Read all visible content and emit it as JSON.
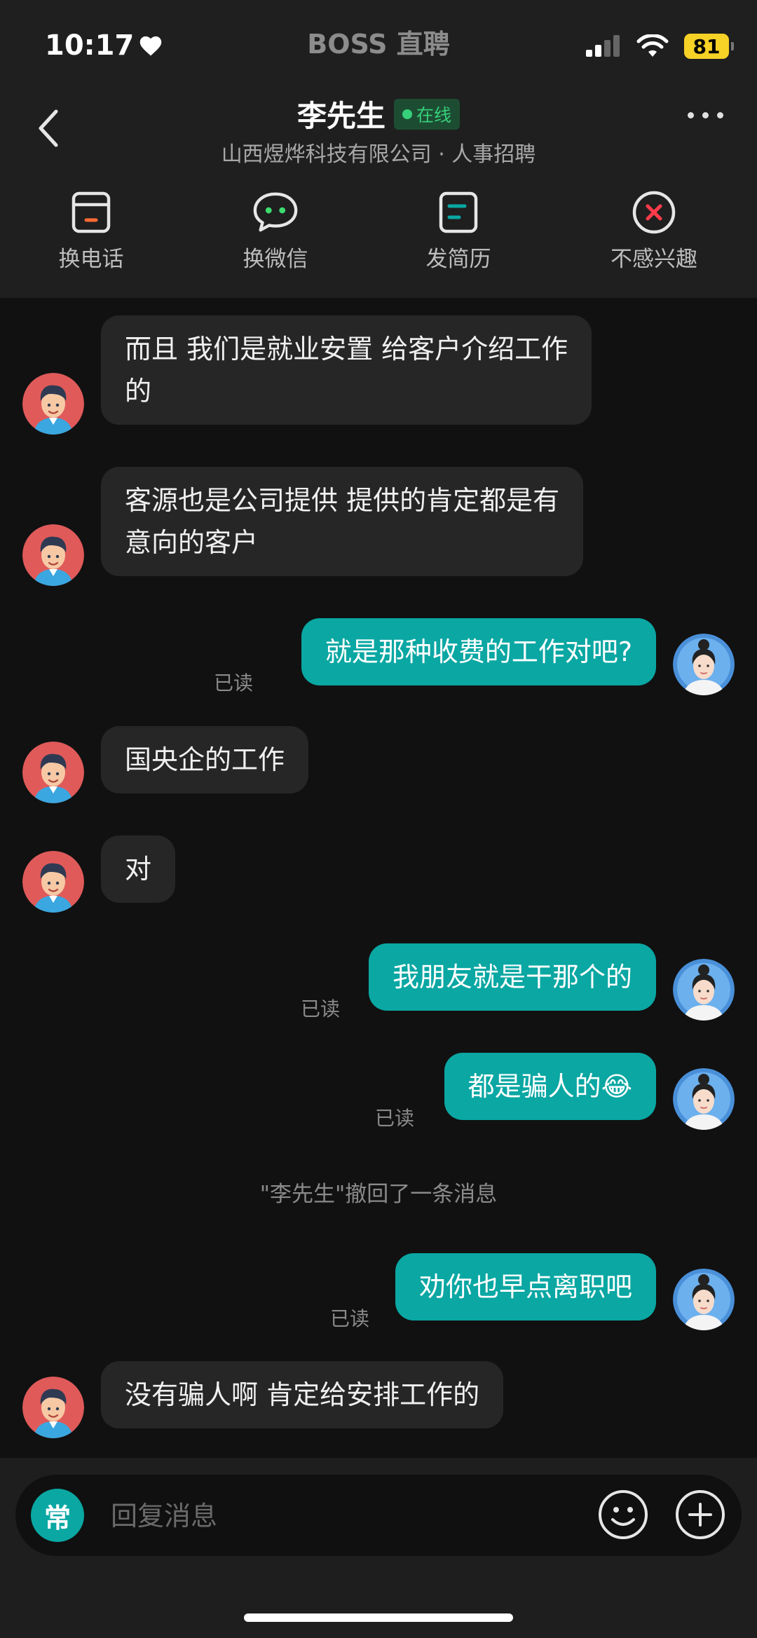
{
  "status": {
    "time": "10:17",
    "app_name": "BOSS 直聘",
    "battery": "81"
  },
  "header": {
    "name": "李先生",
    "online": "在线",
    "subtitle": "山西煜烨科技有限公司 · 人事招聘"
  },
  "actions": [
    {
      "label": "换电话",
      "icon": "phone-card-icon"
    },
    {
      "label": "换微信",
      "icon": "wechat-icon"
    },
    {
      "label": "发简历",
      "icon": "resume-icon"
    },
    {
      "label": "不感兴趣",
      "icon": "not-interested-icon"
    }
  ],
  "messages": {
    "m1": {
      "line1": "而且 我们是就业安置 给客户介绍工作",
      "line2": "的"
    },
    "m2": {
      "line1": "客源也是公司提供  提供的肯定都是有",
      "line2": "意向的客户"
    },
    "m3": {
      "text": "就是那种收费的工作对吧?",
      "status": "已读"
    },
    "m4": {
      "text": "国央企的工作"
    },
    "m5": {
      "text": "对"
    },
    "m6": {
      "text": "我朋友就是干那个的",
      "status": "已读"
    },
    "m7": {
      "text": "都是骗人的",
      "emoji": "😂",
      "status": "已读"
    },
    "recall": "\"李先生\"撤回了一条消息",
    "m8": {
      "text": "劝你也早点离职吧",
      "status": "已读"
    },
    "m9": {
      "text": "没有骗人啊 肯定给安排工作的"
    }
  },
  "input": {
    "common_label": "常",
    "placeholder": "回复消息"
  },
  "colors": {
    "bubble_out": "#0aa7a3",
    "bubble_in": "#262626",
    "online": "#37d07a",
    "battery": "#f6d126"
  }
}
